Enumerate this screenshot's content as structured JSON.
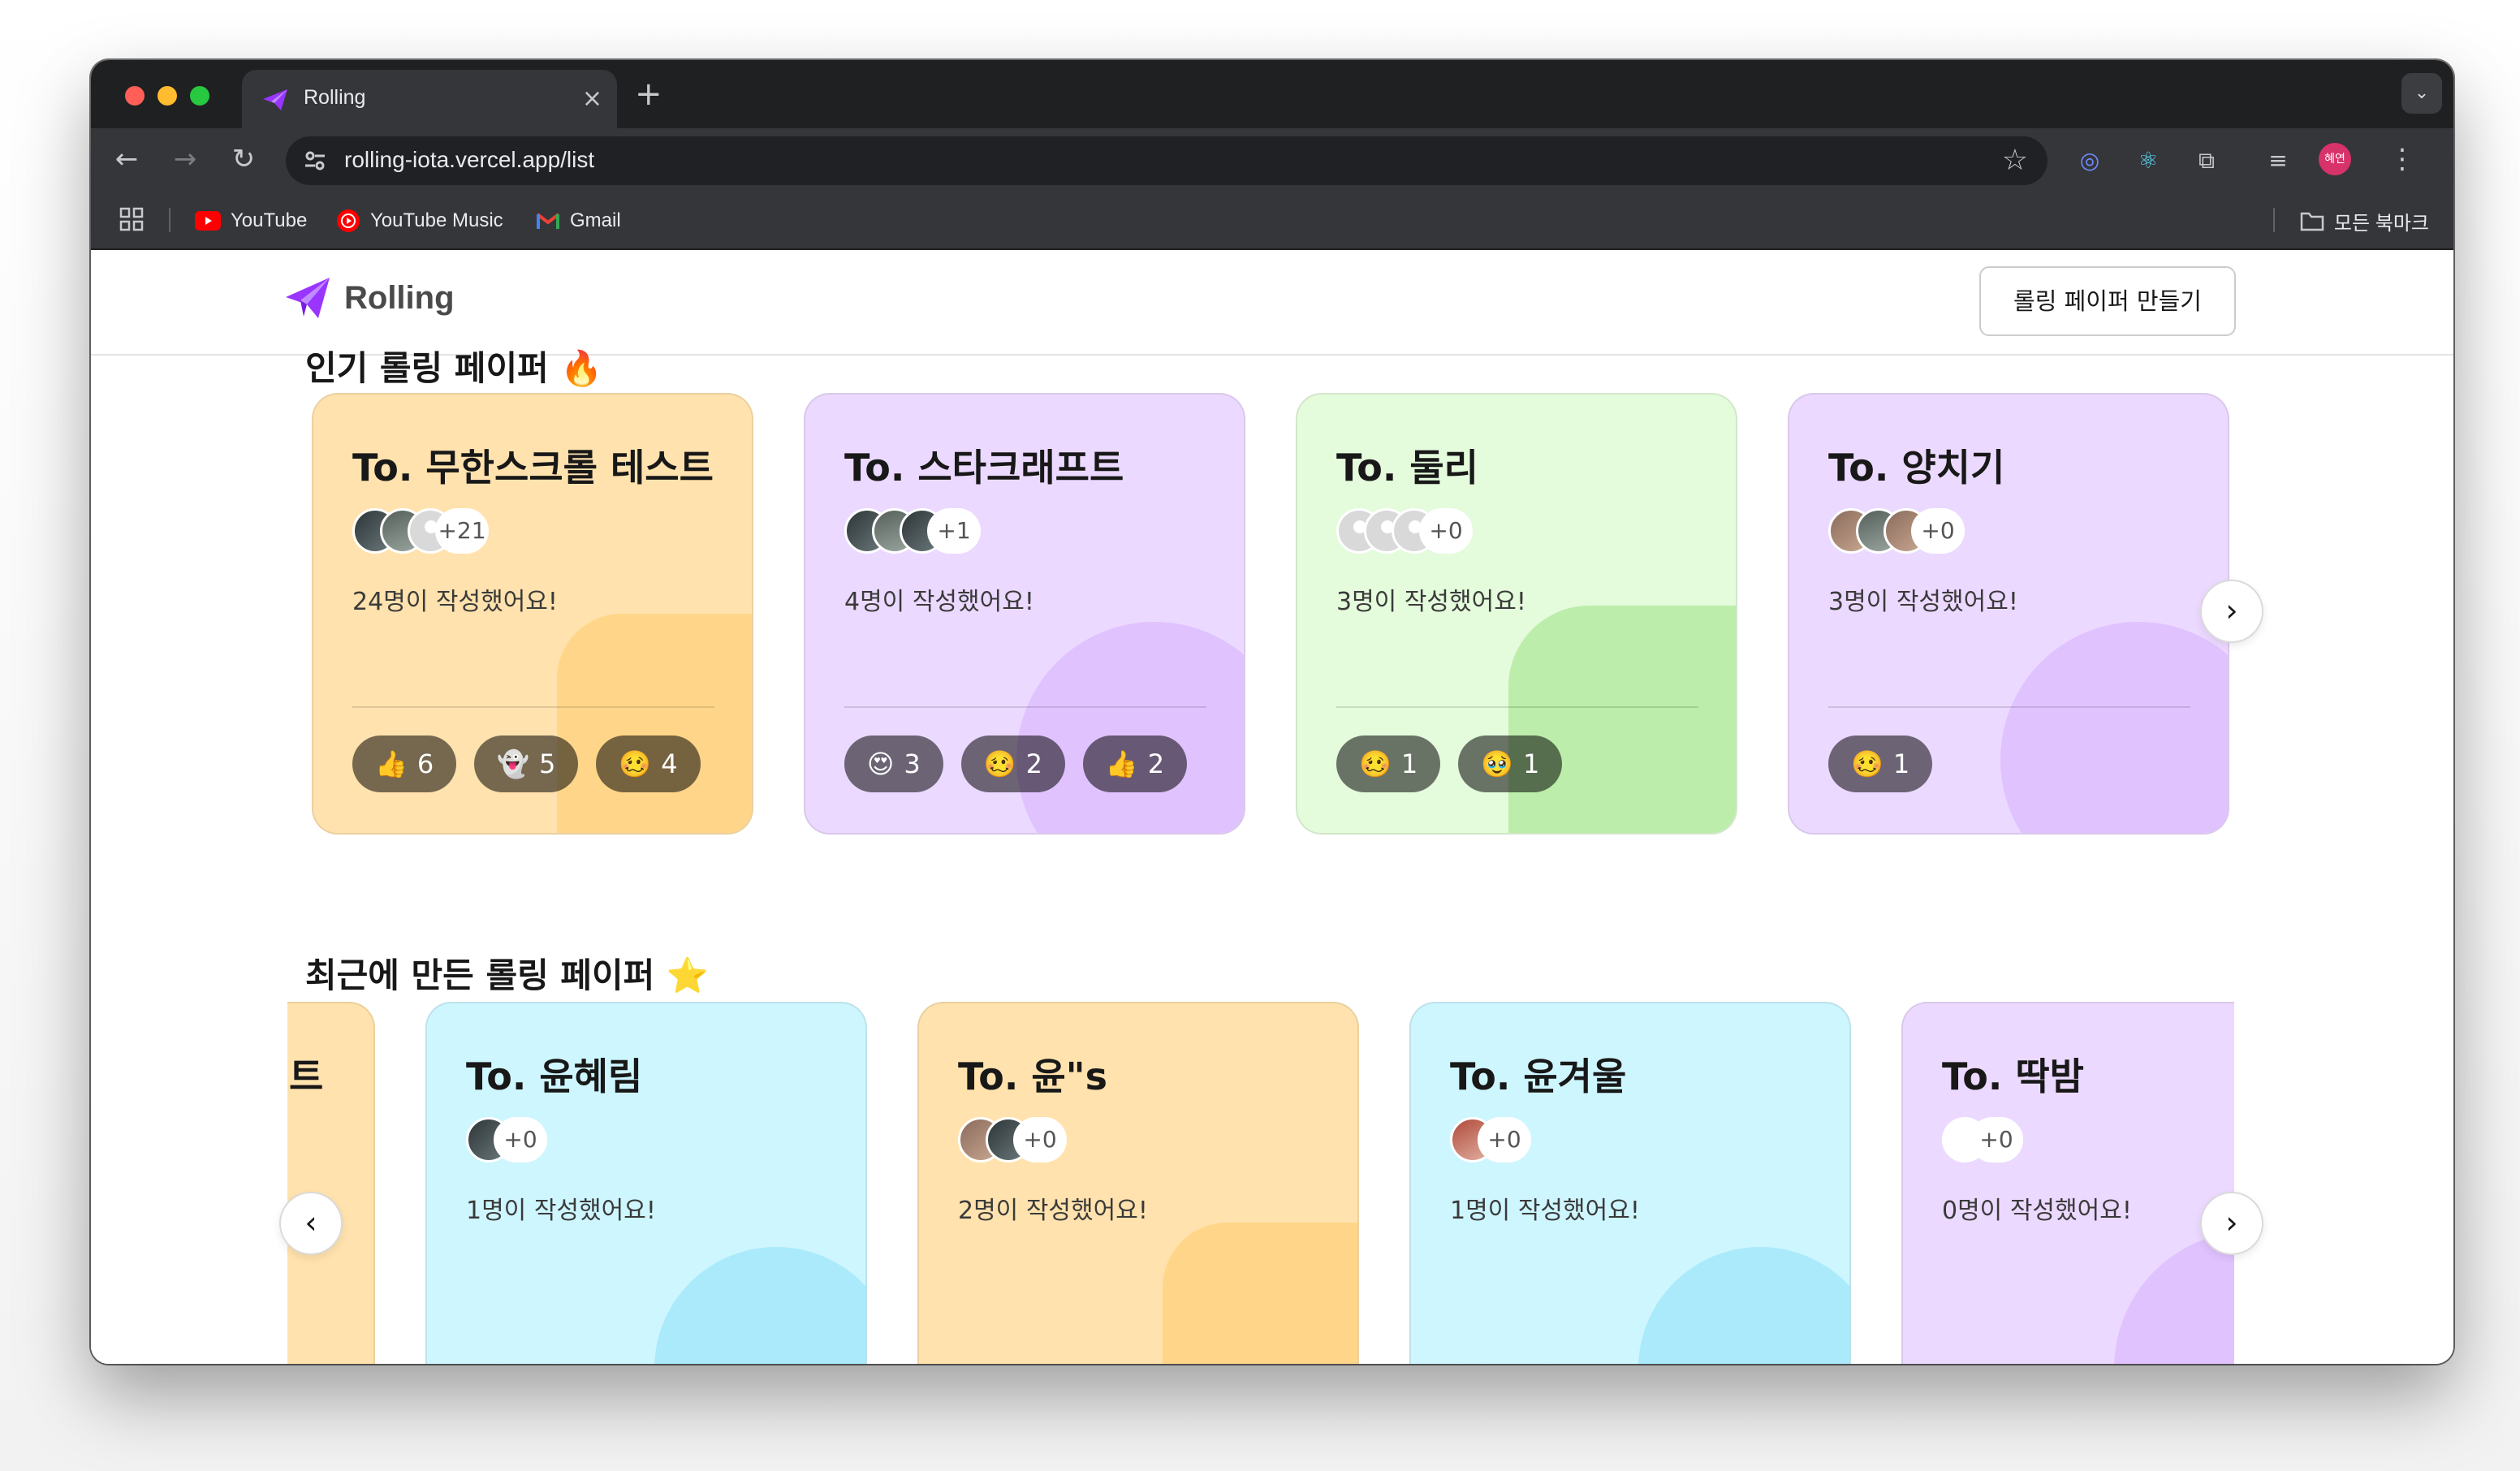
{
  "browser": {
    "tab_title": "Rolling",
    "close_glyph": "×",
    "new_tab_glyph": "+",
    "menu_glyph": "⌄",
    "url": "rolling-iota.vercel.app/list",
    "profile_initials": "혜연",
    "bookmarks": [
      {
        "label": "YouTube",
        "icon": "youtube-icon"
      },
      {
        "label": "YouTube Music",
        "icon": "youtube-music-icon"
      },
      {
        "label": "Gmail",
        "icon": "gmail-icon"
      }
    ],
    "all_bookmarks_label": "모든 북마크"
  },
  "header": {
    "logo_text": "Rolling",
    "create_button": "롤링 페이퍼 만들기"
  },
  "popular": {
    "title": "인기 롤링 페이퍼 🔥",
    "cards": [
      {
        "to": "To. 무한스크롤 테스트",
        "color": "orange",
        "more": "+21",
        "count_text": "24명이 작성했어요!",
        "reactions": [
          {
            "emoji": "👍",
            "count": "6"
          },
          {
            "emoji": "👻",
            "count": "5"
          },
          {
            "emoji": "🥴",
            "count": "4"
          }
        ]
      },
      {
        "to": "To. 스타크래프트",
        "color": "purple",
        "more": "+1",
        "count_text": "4명이 작성했어요!",
        "reactions": [
          {
            "emoji": "😍",
            "count": "3"
          },
          {
            "emoji": "🥴",
            "count": "2"
          },
          {
            "emoji": "👍",
            "count": "2"
          }
        ]
      },
      {
        "to": "To. 둘리",
        "color": "green",
        "more": "+0",
        "count_text": "3명이 작성했어요!",
        "reactions": [
          {
            "emoji": "🥴",
            "count": "1"
          },
          {
            "emoji": "🥹",
            "count": "1"
          }
        ]
      },
      {
        "to": "To. 양치기",
        "color": "purple",
        "more": "+0",
        "count_text": "3명이 작성했어요!",
        "reactions": [
          {
            "emoji": "🥴",
            "count": "1"
          }
        ]
      }
    ]
  },
  "recent": {
    "title": "최근에 만든 롤링 페이퍼 ⭐️",
    "partial_card_text": "트",
    "cards": [
      {
        "to": "To. 윤혜림",
        "color": "blue",
        "more": "+0",
        "count_text": "1명이 작성했어요!"
      },
      {
        "to": "To. 윤\"s",
        "color": "orange",
        "more": "+0",
        "count_text": "2명이 작성했어요!"
      },
      {
        "to": "To. 윤겨울",
        "color": "blue",
        "more": "+0",
        "count_text": "1명이 작성했어요!"
      },
      {
        "to": "To. 딱밤",
        "color": "purple",
        "more": "+0",
        "count_text": "0명이 작성했어요!"
      }
    ]
  },
  "arrows": {
    "next": "›",
    "prev": "‹"
  }
}
